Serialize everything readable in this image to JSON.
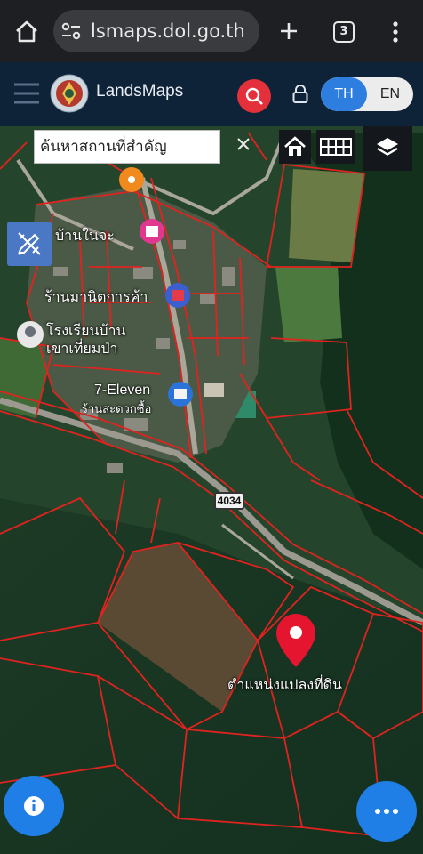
{
  "browser": {
    "url": "lsmaps.dol.go.th",
    "tab_count": "3"
  },
  "header": {
    "brand": "LandsMaps",
    "lang_th": "TH",
    "lang_en": "EN"
  },
  "search": {
    "placeholder": "ค้นหาสถานที่สำคัญ"
  },
  "map": {
    "labels": {
      "village": "บ้านในจะ",
      "shop": "ร้านมานิตการค้า",
      "school_line1": "โรงเรียนบ้าน",
      "school_line2": "เขาเที่ยมป่า",
      "seven_eleven": "7-Eleven",
      "shop2": "ร้านสะดวกซื้อ",
      "road_shield": "4034",
      "parcel": "ตำแหน่งแปลงที่ดิน"
    }
  },
  "colors": {
    "parcel_line": "#e0231f",
    "pin": "#e5152f",
    "fab": "#1f7fe6"
  },
  "icons": [
    "home-icon",
    "tab-switcher-icon",
    "menu-dots-icon",
    "hamburger-icon",
    "search-icon",
    "lock-icon",
    "close-icon",
    "basemap-home-icon",
    "grid-icon",
    "layers-icon",
    "draw-tool-icon",
    "info-icon",
    "more-icon",
    "location-pin-icon"
  ]
}
